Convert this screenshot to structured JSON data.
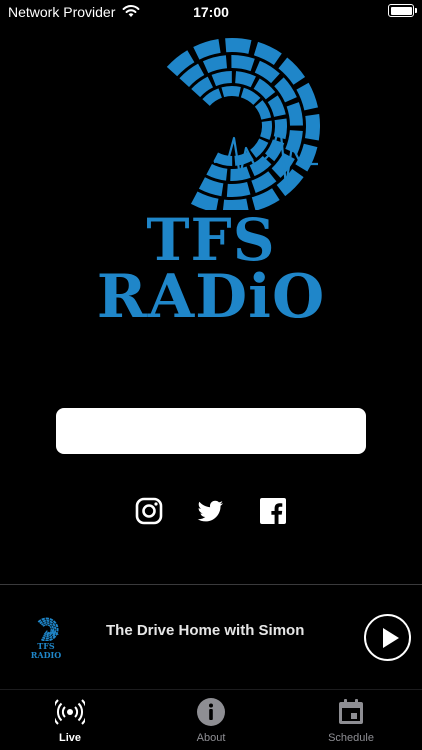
{
  "status_bar": {
    "carrier": "Network Provider",
    "time": "17:00"
  },
  "logo": {
    "line1": "TFS",
    "line2": "RADiO",
    "color": "#1f86c9"
  },
  "social": {
    "icons": [
      "instagram-icon",
      "twitter-icon",
      "facebook-icon"
    ]
  },
  "player": {
    "mini_logo_line1": "TFS",
    "mini_logo_line2": "RADIO",
    "show_title": "The Drive Home with Simon"
  },
  "tabs": [
    {
      "label": "Live",
      "icon": "broadcast-icon",
      "active": true
    },
    {
      "label": "About",
      "icon": "info-icon",
      "active": false
    },
    {
      "label": "Schedule",
      "icon": "calendar-icon",
      "active": false
    }
  ]
}
